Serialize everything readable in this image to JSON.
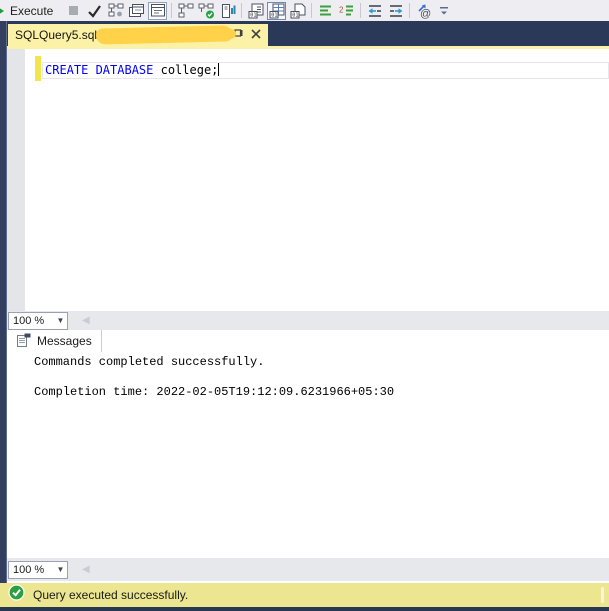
{
  "toolbar": {
    "execute_label": "Execute",
    "icons": [
      "play-icon",
      "stop-icon",
      "parse-check-icon",
      "estimated-plan-icon",
      "query-options-icon",
      "intellisense-icon",
      "actual-execution-plan-icon",
      "live-query-statistics-icon",
      "client-statistics-icon",
      "results-to-text-icon",
      "results-to-grid-icon",
      "results-to-file-icon",
      "comment-icon",
      "uncomment-icon",
      "outdent-icon",
      "indent-icon",
      "template-parameters-icon",
      "toolbar-overflow-icon"
    ]
  },
  "document_tab": {
    "title": "SQLQuery5.sql - "
  },
  "editor": {
    "keyword": "CREATE DATABASE",
    "code_rest": " college;",
    "zoom_value": "100 %"
  },
  "messages_panel": {
    "tab_label": "Messages",
    "line1": "Commands completed successfully.",
    "line2": "Completion time: 2022-02-05T19:12:09.6231966+05:30",
    "zoom_value": "100 %"
  },
  "status_bar": {
    "text": "Query executed successfully."
  },
  "colors": {
    "tab_strip": "#2A3957",
    "active_tab": "#FBF2A7",
    "redaction": "#FFD24A",
    "keyword_blue": "#0000FA",
    "track_change_yellow": "#F1E64E",
    "status_bar_bg": "#EBE68F",
    "success_green": "#2C9E44"
  }
}
